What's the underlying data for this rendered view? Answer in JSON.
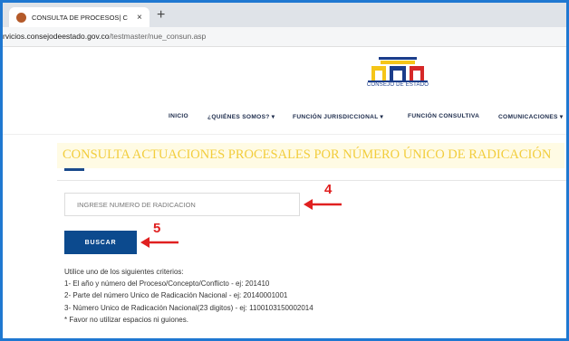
{
  "browser": {
    "tab_title": "CONSULTA DE PROCESOS| C",
    "tab_close": "×",
    "new_tab": "+",
    "url_domain": "rvicios.consejodeestado.gov.co",
    "url_path": "/testmaster/nue_consun.asp"
  },
  "header": {
    "logo_text": "CONSEJO DE ESTADO",
    "logo_colors": [
      "#f5c518",
      "#1b3d8a",
      "#d62828"
    ]
  },
  "nav": {
    "items": [
      {
        "label": "INICIO"
      },
      {
        "label": "¿QUIÉNES SOMOS? ▾"
      },
      {
        "label": "FUNCIÓN JURISDICCIONAL ▾"
      },
      {
        "label": "FUNCIÓN CONSULTIVA"
      },
      {
        "label": "COMUNICACIONES ▾"
      }
    ]
  },
  "main": {
    "title": "CONSULTA ACTUACIONES PROCESALES POR NÚMERO ÚNICO DE RADICACIÓN",
    "input_placeholder": "INGRESE NUMERO DE RADICACION",
    "search_button": "BUSCAR",
    "criteria": [
      "Utilice uno de los siguientes criterios:",
      "1- El año y número del Proceso/Concepto/Conflicto - ej: 201410",
      "2- Parte del número Unico de Radicación Nacional - ej: 20140001001",
      "3- Número Unico de Radicación Nacional(23 digitos) - ej: 1100103150002014",
      "* Favor no utilizar espacios ni guiones."
    ]
  },
  "annotations": {
    "step4": "4",
    "step5": "5",
    "color": "#e02020"
  }
}
